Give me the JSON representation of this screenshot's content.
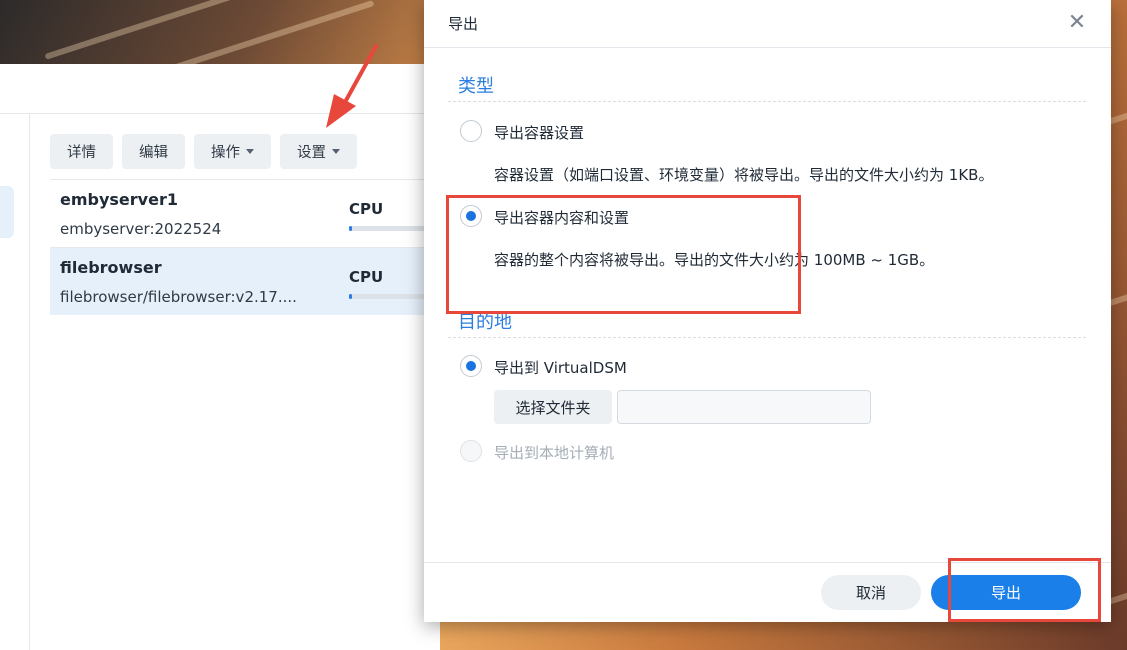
{
  "background_app": {
    "toolbar": {
      "details": "详情",
      "edit": "编辑",
      "action": "操作",
      "settings": "设置"
    },
    "containers": [
      {
        "name": "embyserver1",
        "image": "embyserver:2022524",
        "cpu_label": "CPU",
        "cpu_usage": 0.03,
        "selected": false
      },
      {
        "name": "filebrowser",
        "image": "filebrowser/filebrowser:v2.17....",
        "cpu_label": "CPU",
        "cpu_usage": 0.03,
        "selected": true
      }
    ]
  },
  "dialog": {
    "title": "导出",
    "close_icon": "close-icon",
    "type_section": {
      "title": "类型",
      "options": [
        {
          "label": "导出容器设置",
          "description": "容器设置（如端口设置、环境变量）将被导出。导出的文件大小约为 1KB。",
          "checked": false
        },
        {
          "label": "导出容器内容和设置",
          "description": "容器的整个内容将被导出。导出的文件大小约为 100MB ~ 1GB。",
          "checked": true
        }
      ]
    },
    "destination_section": {
      "title": "目的地",
      "options": [
        {
          "label": "导出到 VirtualDSM",
          "checked": true,
          "disabled": false
        },
        {
          "label": "导出到本地计算机",
          "checked": false,
          "disabled": true
        }
      ],
      "choose_folder": "选择文件夹",
      "folder_value": ""
    },
    "footer": {
      "cancel": "取消",
      "export": "导出"
    }
  },
  "colors": {
    "accent": "#1a7fe8",
    "highlight": "#e8473c"
  }
}
